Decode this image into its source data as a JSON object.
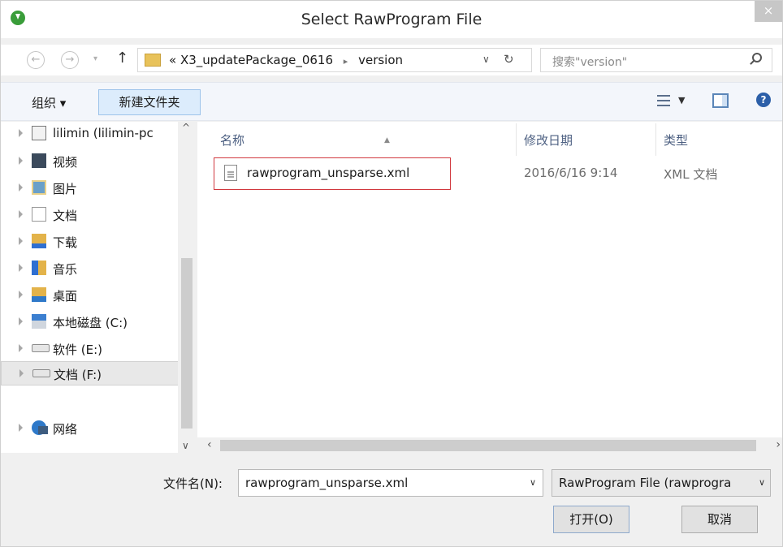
{
  "window": {
    "title": "Select RawProgram File",
    "close_label": "×"
  },
  "address": {
    "prefix": "«",
    "path": [
      "X3_updatePackage_0616",
      "version"
    ],
    "separator": "▸",
    "search_placeholder": "搜索\"version\""
  },
  "toolbar": {
    "organize_label": "组织 ▾",
    "new_folder_label": "新建文件夹"
  },
  "sidebar": {
    "items": [
      {
        "label": "lilimin (lilimin-pc",
        "icon": "user-computer-icon"
      },
      {
        "label": "视频",
        "icon": "video-folder-icon"
      },
      {
        "label": "图片",
        "icon": "pictures-folder-icon"
      },
      {
        "label": "文档",
        "icon": "documents-folder-icon"
      },
      {
        "label": "下载",
        "icon": "downloads-folder-icon"
      },
      {
        "label": "音乐",
        "icon": "music-folder-icon"
      },
      {
        "label": "桌面",
        "icon": "desktop-folder-icon"
      },
      {
        "label": "本地磁盘 (C:)",
        "icon": "local-disk-icon"
      },
      {
        "label": "软件 (E:)",
        "icon": "drive-icon"
      },
      {
        "label": "文档 (F:)",
        "icon": "drive-icon",
        "selected": true
      },
      {
        "label": "网络",
        "icon": "network-icon"
      }
    ]
  },
  "filelist": {
    "columns": {
      "name": "名称",
      "date": "修改日期",
      "type": "类型"
    },
    "rows": [
      {
        "name": "rawprogram_unsparse.xml",
        "date": "2016/6/16 9:14",
        "type": "XML 文档"
      }
    ]
  },
  "footer": {
    "filename_label": "文件名(N):",
    "filename_value": "rawprogram_unsparse.xml",
    "filetype_value": "RawProgram File (rawprogra",
    "open_label": "打开(O)",
    "cancel_label": "取消"
  },
  "colors": {
    "selection_border": "#d1383e",
    "accent": "#2c5fa8"
  }
}
